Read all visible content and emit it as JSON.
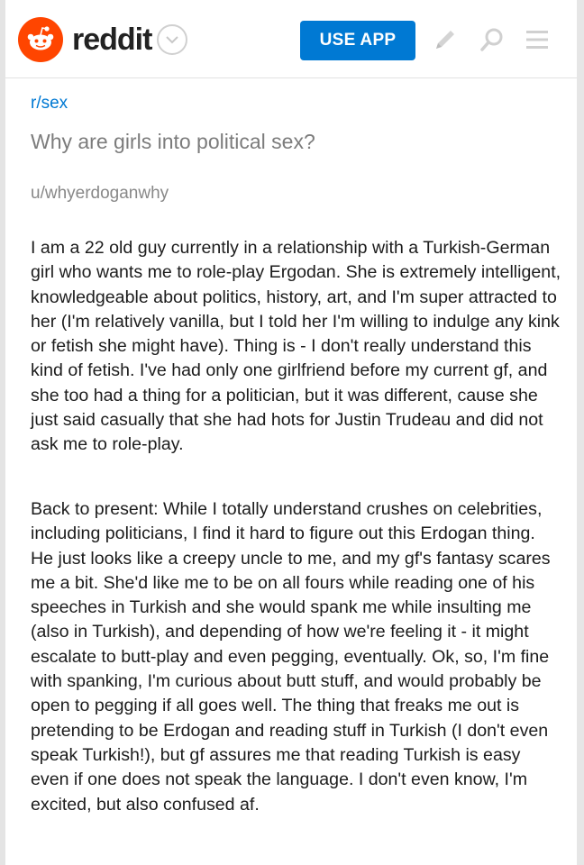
{
  "header": {
    "logo_text": "reddit",
    "use_app_label": "USE APP",
    "brand_color": "#ff4500",
    "button_color": "#0079d3",
    "icons": [
      "reddit-snoo-icon",
      "chevron-down-icon",
      "pencil-icon",
      "search-icon",
      "menu-icon"
    ]
  },
  "post": {
    "subreddit": "r/sex",
    "title": "Why are girls into political sex?",
    "author": "u/whyerdoganwhy",
    "paragraphs": [
      "I am a 22 old guy currently in a relationship with a Turkish-German girl who wants me to role-play Ergodan. She is extremely intelligent, knowledgeable about politics, history, art, and I'm super attracted to her (I'm relatively vanilla, but I told her I'm willing to indulge any kink or fetish she might have). Thing is - I don't really understand this kind of fetish. I've had only one girlfriend before my current gf, and she too had a thing for a politician, but it was different, cause she just said casually that she had hots for Justin Trudeau and did not ask me to role-play.",
      "Back to present: While I totally understand crushes on celebrities, including politicians, I find it hard to figure out this Erdogan thing. He just looks like a creepy uncle to me, and my gf's fantasy scares me a bit. She'd like me to be on all fours while reading one of his speeches in Turkish and she would spank me while insulting me (also in Turkish), and depending of how we're feeling it - it might escalate to butt-play and even pegging, eventually. Ok, so, I'm fine with spanking, I'm curious about butt stuff, and would probably be open to pegging if all goes well. The thing that freaks me out is pretending to be Erdogan and reading stuff in Turkish (I don't even speak Turkish!), but gf assures me that reading Turkish is easy even if one does not speak the language. I don't even know, I'm excited, but also confused af."
    ]
  }
}
